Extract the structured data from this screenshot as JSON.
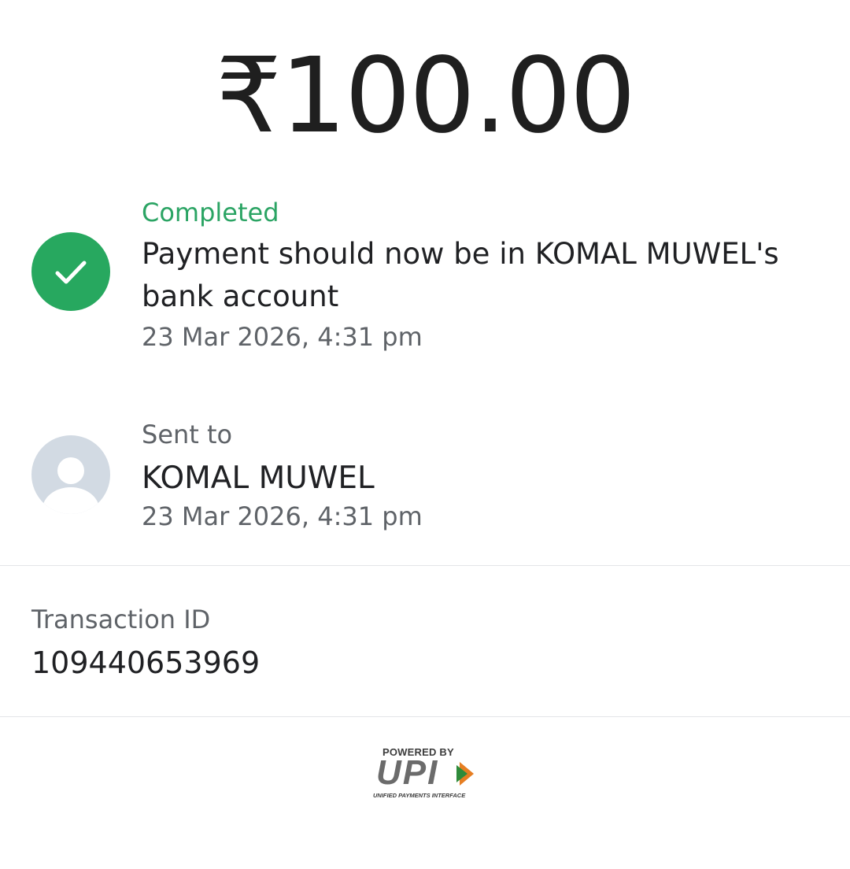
{
  "amount": "₹100.00",
  "status": {
    "label": "Completed",
    "message": "Payment should now be in KOMAL MUWEL's bank account",
    "timestamp": "23 Mar 2026, 4:31 pm",
    "icon": "check-circle-icon",
    "color": "#27a85f"
  },
  "recipient": {
    "label": "Sent to",
    "name": "KOMAL MUWEL",
    "timestamp": "23 Mar 2026, 4:31 pm",
    "icon": "avatar-icon"
  },
  "transaction": {
    "label": "Transaction ID",
    "id": "109440653969"
  },
  "footer": {
    "powered_by": "POWERED BY",
    "brand": "UPI",
    "brand_sub": "UNIFIED PAYMENTS INTERFACE"
  }
}
